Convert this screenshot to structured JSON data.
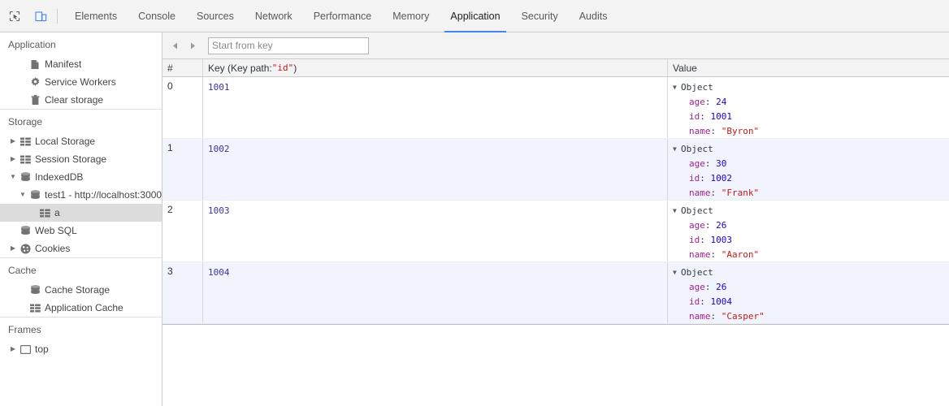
{
  "toolbar": {
    "inspect_icon": "inspect-cursor-icon",
    "device_icon": "device-toolbar-icon",
    "tabs": [
      {
        "label": "Elements",
        "active": false
      },
      {
        "label": "Console",
        "active": false
      },
      {
        "label": "Sources",
        "active": false
      },
      {
        "label": "Network",
        "active": false
      },
      {
        "label": "Performance",
        "active": false
      },
      {
        "label": "Memory",
        "active": false
      },
      {
        "label": "Application",
        "active": true
      },
      {
        "label": "Security",
        "active": false
      },
      {
        "label": "Audits",
        "active": false
      }
    ],
    "active_tab_underline_color": "#4285f4"
  },
  "sidebar": {
    "sections": [
      {
        "header": "Application",
        "items": [
          {
            "label": "Manifest",
            "icon": "manifest-icon",
            "twisty": "",
            "indent": 1,
            "selected": false
          },
          {
            "label": "Service Workers",
            "icon": "gear-icon",
            "twisty": "",
            "indent": 1,
            "selected": false
          },
          {
            "label": "Clear storage",
            "icon": "trash-icon",
            "twisty": "",
            "indent": 1,
            "selected": false
          }
        ]
      },
      {
        "header": "Storage",
        "items": [
          {
            "label": "Local Storage",
            "icon": "table-icon",
            "twisty": "collapsed",
            "indent": 0,
            "selected": false
          },
          {
            "label": "Session Storage",
            "icon": "table-icon",
            "twisty": "collapsed",
            "indent": 0,
            "selected": false
          },
          {
            "label": "IndexedDB",
            "icon": "database-icon",
            "twisty": "expanded",
            "indent": 0,
            "selected": false
          },
          {
            "label": "test1 - http://localhost:3000",
            "icon": "database-icon",
            "twisty": "expanded",
            "indent": 1,
            "selected": false
          },
          {
            "label": "a",
            "icon": "table-icon",
            "twisty": "",
            "indent": 2,
            "selected": true
          },
          {
            "label": "Web SQL",
            "icon": "database-icon",
            "twisty": "",
            "indent": 0,
            "selected": false
          },
          {
            "label": "Cookies",
            "icon": "cookie-icon",
            "twisty": "collapsed",
            "indent": 0,
            "selected": false
          }
        ]
      },
      {
        "header": "Cache",
        "items": [
          {
            "label": "Cache Storage",
            "icon": "database-icon",
            "twisty": "",
            "indent": 1,
            "selected": false
          },
          {
            "label": "Application Cache",
            "icon": "table-icon",
            "twisty": "",
            "indent": 1,
            "selected": false
          }
        ]
      },
      {
        "header": "Frames",
        "items": [
          {
            "label": "top",
            "icon": "frame-icon",
            "twisty": "collapsed",
            "indent": 0,
            "selected": false
          }
        ]
      }
    ]
  },
  "idb_toolbar": {
    "prev_icon": "arrow-left-icon",
    "next_icon": "arrow-right-icon",
    "start_from_key_placeholder": "Start from key",
    "start_from_key_value": ""
  },
  "grid": {
    "columns": {
      "index": "#",
      "key_prefix": "Key (Key path: ",
      "key_path": "\"id\"",
      "key_suffix": ")",
      "value": "Value"
    },
    "object_label": "Object",
    "expand_triangle": "▼",
    "rows": [
      {
        "index": "0",
        "key": "1001",
        "props": [
          {
            "name": "age",
            "value": "24",
            "type": "number"
          },
          {
            "name": "id",
            "value": "1001",
            "type": "number"
          },
          {
            "name": "name",
            "value": "\"Byron\"",
            "type": "string"
          }
        ]
      },
      {
        "index": "1",
        "key": "1002",
        "props": [
          {
            "name": "age",
            "value": "30",
            "type": "number"
          },
          {
            "name": "id",
            "value": "1002",
            "type": "number"
          },
          {
            "name": "name",
            "value": "\"Frank\"",
            "type": "string"
          }
        ]
      },
      {
        "index": "2",
        "key": "1003",
        "props": [
          {
            "name": "age",
            "value": "26",
            "type": "number"
          },
          {
            "name": "id",
            "value": "1003",
            "type": "number"
          },
          {
            "name": "name",
            "value": "\"Aaron\"",
            "type": "string"
          }
        ]
      },
      {
        "index": "3",
        "key": "1004",
        "props": [
          {
            "name": "age",
            "value": "26",
            "type": "number"
          },
          {
            "name": "id",
            "value": "1004",
            "type": "number"
          },
          {
            "name": "name",
            "value": "\"Casper\"",
            "type": "string"
          }
        ]
      }
    ]
  },
  "colors": {
    "accent": "#4285f4",
    "key_text": "#3a32a0",
    "prop_name": "#a3218e",
    "prop_number": "#1c00cf",
    "prop_string": "#c41a16",
    "row_stripe": "#f1f4fd",
    "selected_sidebar": "#dcdcdc"
  }
}
